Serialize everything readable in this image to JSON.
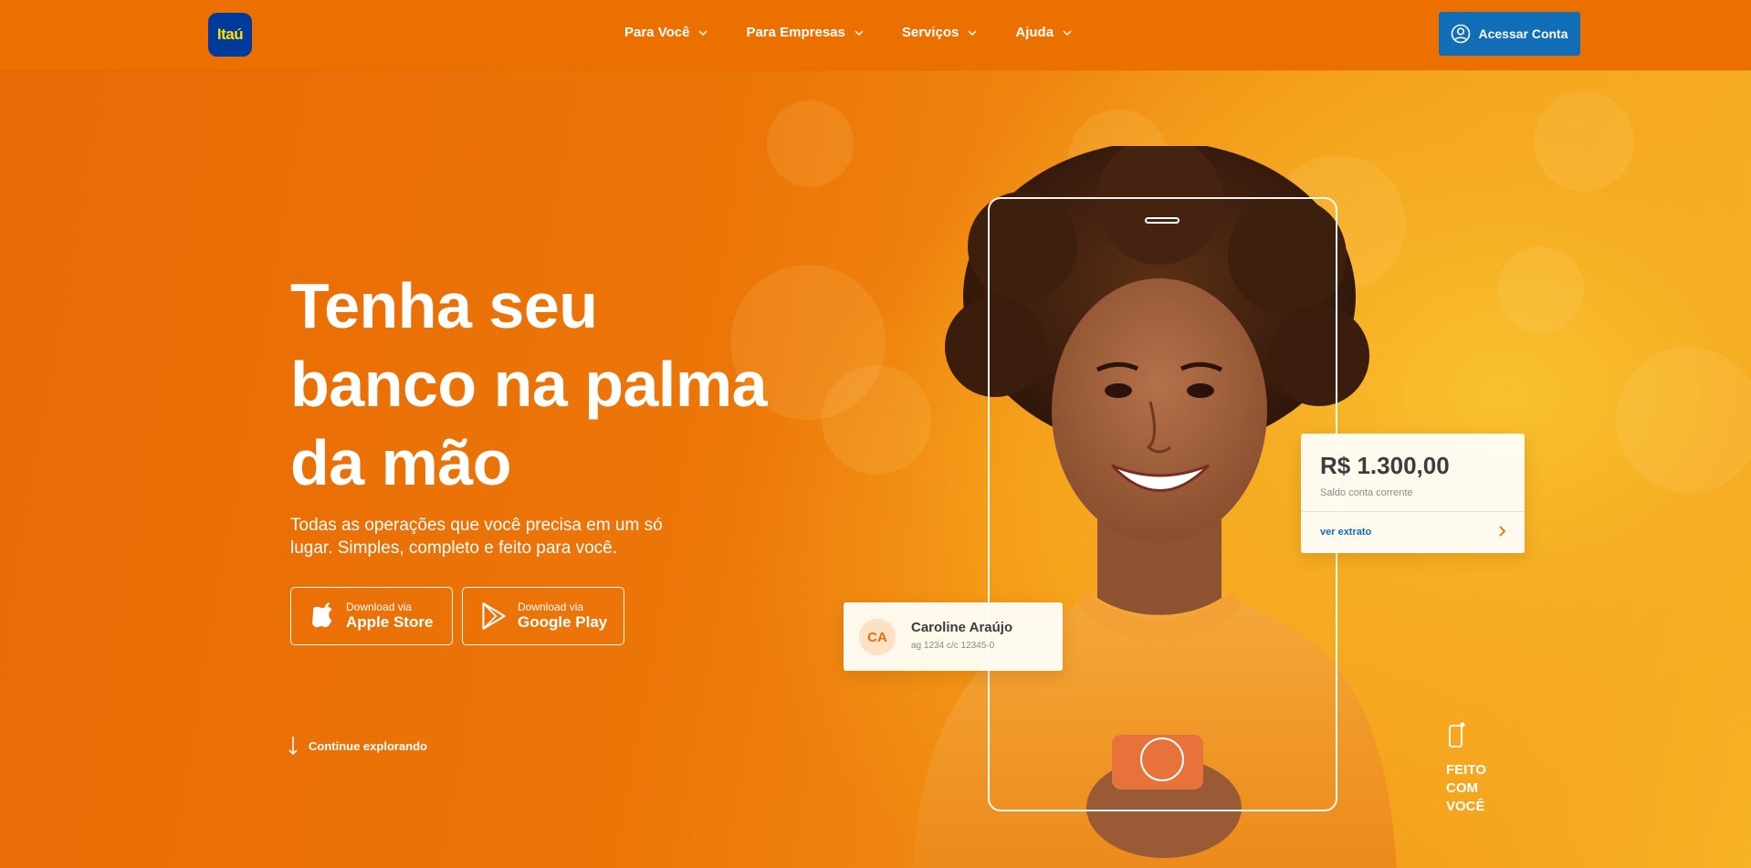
{
  "header": {
    "logo_text": "Itaú",
    "nav": [
      {
        "label": "Para Você"
      },
      {
        "label": "Para Empresas"
      },
      {
        "label": "Serviços"
      },
      {
        "label": "Ajuda"
      }
    ],
    "access_button": "Acessar Conta"
  },
  "hero": {
    "headline": "Tenha seu banco na palma da mão",
    "headline_lines": [
      "Tenha seu",
      "banco na palma",
      "da mão"
    ],
    "subtitle_lines": [
      "Todas as operações que você precisa em um só",
      "lugar. Simples, completo e feito para você."
    ],
    "stores": {
      "apple": {
        "small": "Download via",
        "big": "Apple Store",
        "icon": "apple-icon"
      },
      "google": {
        "small": "Download via",
        "big": "Google Play",
        "icon": "google-play-icon"
      }
    },
    "explore": "Continue explorando"
  },
  "balance_card": {
    "amount": "R$ 1.300,00",
    "label": "Saldo conta corrente",
    "link": "ver extrato"
  },
  "user_card": {
    "initials": "CA",
    "name": "Caroline Araújo",
    "account": "ag 1234  c/c 12345-0"
  },
  "made_with_you": [
    "FEITO",
    "COM",
    "VOCÊ"
  ],
  "colors": {
    "brand_orange": "#ec7000",
    "brand_blue": "#106eb9",
    "logo_blue": "#003a9c",
    "logo_yellow": "#ffe000"
  }
}
